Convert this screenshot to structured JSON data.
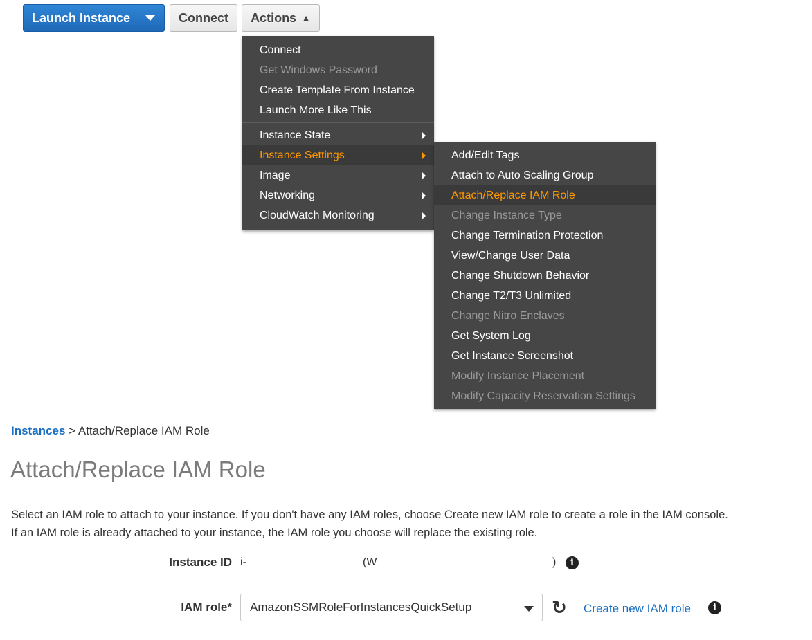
{
  "toolbar": {
    "launch_label": "Launch Instance",
    "connect_label": "Connect",
    "actions_label": "Actions"
  },
  "actions_menu": {
    "items": [
      {
        "label": "Connect",
        "disabled": false
      },
      {
        "label": "Get Windows Password",
        "disabled": true
      },
      {
        "label": "Create Template From Instance",
        "disabled": false
      },
      {
        "label": "Launch More Like This",
        "disabled": false
      },
      {
        "label": "Instance State",
        "submenu": true
      },
      {
        "label": "Instance Settings",
        "submenu": true,
        "active": true
      },
      {
        "label": "Image",
        "submenu": true
      },
      {
        "label": "Networking",
        "submenu": true
      },
      {
        "label": "CloudWatch Monitoring",
        "submenu": true
      }
    ]
  },
  "settings_submenu": {
    "items": [
      {
        "label": "Add/Edit Tags",
        "disabled": false
      },
      {
        "label": "Attach to Auto Scaling Group",
        "disabled": false
      },
      {
        "label": "Attach/Replace IAM Role",
        "active": true
      },
      {
        "label": "Change Instance Type",
        "disabled": true
      },
      {
        "label": "Change Termination Protection",
        "disabled": false
      },
      {
        "label": "View/Change User Data",
        "disabled": false
      },
      {
        "label": "Change Shutdown Behavior",
        "disabled": false
      },
      {
        "label": "Change T2/T3 Unlimited",
        "disabled": false
      },
      {
        "label": "Change Nitro Enclaves",
        "disabled": true
      },
      {
        "label": "Get System Log",
        "disabled": false
      },
      {
        "label": "Get Instance Screenshot",
        "disabled": false
      },
      {
        "label": "Modify Instance Placement",
        "disabled": true
      },
      {
        "label": "Modify Capacity Reservation Settings",
        "disabled": true
      }
    ]
  },
  "breadcrumb": {
    "root": "Instances",
    "separator": " > ",
    "current": "Attach/Replace IAM Role"
  },
  "page": {
    "title": "Attach/Replace IAM Role",
    "description_line1": "Select an IAM role to attach to your instance. If you don't have any IAM roles, choose Create new IAM role to create a role in the IAM console.",
    "description_line2": "If an IAM role is already attached to your instance, the IAM role you choose will replace the existing role."
  },
  "form": {
    "instance_id_label": "Instance ID",
    "instance_id_prefix": "i-",
    "instance_name_open": "(W",
    "instance_name_close": ")",
    "iam_role_label": "IAM role*",
    "iam_role_value": "AmazonSSMRoleForInstancesQuickSetup",
    "create_role_link": "Create new IAM role"
  },
  "icons": {
    "launch_split": "caret-down-icon",
    "actions_open": "chevron-up-icon",
    "info": "info-icon",
    "refresh": "refresh-icon"
  },
  "colors": {
    "primary": "#1f69b8",
    "menu_bg": "#464646",
    "active_text": "#ff9900",
    "link": "#1a6fc2"
  }
}
